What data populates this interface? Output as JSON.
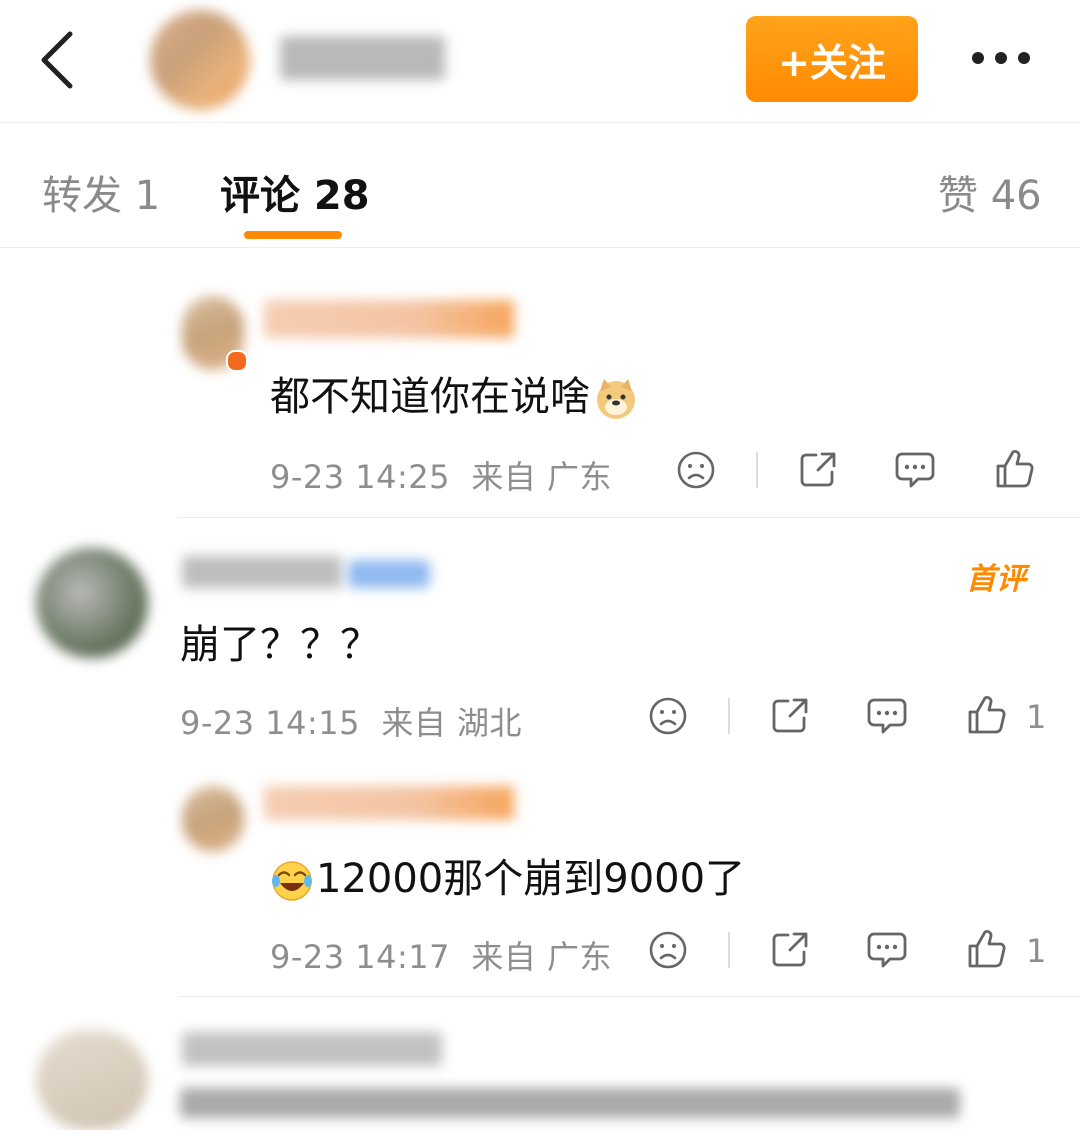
{
  "header": {
    "follow_label": "+关注",
    "accent": "#ff8a00"
  },
  "tabs": {
    "repost": "转发 1",
    "comments": "评论 28",
    "likes": "赞 46"
  },
  "comments": [
    {
      "text": "都不知道你在说啥",
      "emoji": "doge",
      "time": "9-23 14:25",
      "location": "来自 广东",
      "likes": ""
    },
    {
      "text": "崩了？？？",
      "badge": "首评",
      "time": "9-23 14:15",
      "location": "来自 湖北",
      "likes": "1"
    },
    {
      "text": "12000那个崩到9000了",
      "emoji": "laugh-cry",
      "time": "9-23 14:17",
      "location": "来自 广东",
      "likes": "1"
    }
  ]
}
